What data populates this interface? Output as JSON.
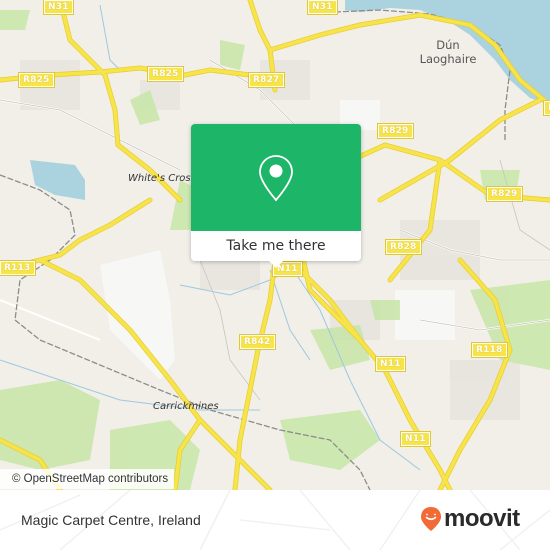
{
  "map": {
    "road_labels": [
      {
        "id": "n31-top-left",
        "text": "N31"
      },
      {
        "id": "n31-top-right",
        "text": "N31"
      },
      {
        "id": "r825-left",
        "text": "R825"
      },
      {
        "id": "r825-mid",
        "text": "R825"
      },
      {
        "id": "r827",
        "text": "R827"
      },
      {
        "id": "r829-left",
        "text": "R829"
      },
      {
        "id": "r829-right",
        "text": "R829"
      },
      {
        "id": "r828",
        "text": "R828"
      },
      {
        "id": "r113",
        "text": "R113"
      },
      {
        "id": "n11-center",
        "text": "N11"
      },
      {
        "id": "r842",
        "text": "R842"
      },
      {
        "id": "n11-mid",
        "text": "N11"
      },
      {
        "id": "r118",
        "text": "R118"
      },
      {
        "id": "n11-bottom",
        "text": "N11"
      },
      {
        "id": "r1-edge",
        "text": "R"
      }
    ],
    "place_labels": {
      "whites_cross": "White's Cross",
      "carrickmines": "Carrickmines",
      "dun_laoghaire_line1": "Dún",
      "dun_laoghaire_line2": "Laoghaire"
    },
    "attribution": "© OpenStreetMap contributors",
    "colors": {
      "land": "#f2efe9",
      "water": "#aad3df",
      "park": "#c8e6a8",
      "road_major": "#f7e34a",
      "popup_green": "#1db567"
    }
  },
  "popup": {
    "icon": "location-pin-icon",
    "button_label": "Take me there"
  },
  "footer": {
    "place_name": "Magic Carpet Centre, Ireland",
    "brand": "moovit",
    "brand_color": "#f26a36"
  }
}
